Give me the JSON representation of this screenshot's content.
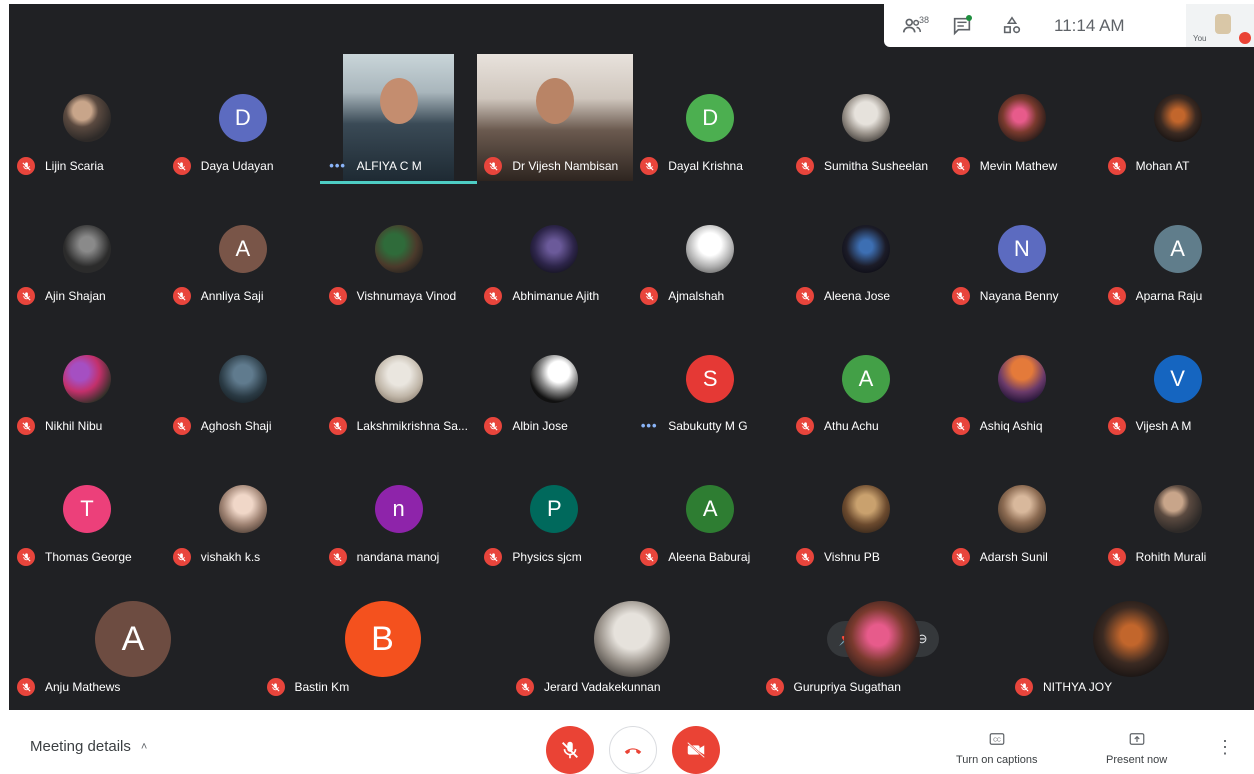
{
  "topbar": {
    "participants_count": "38",
    "clock": "11:14 AM",
    "self_label": "You"
  },
  "participants": [
    {
      "name": "Lijin Scaria",
      "avatar": "photo",
      "status": "muted"
    },
    {
      "name": "Daya Udayan",
      "avatar": "letter",
      "letter": "D",
      "color": "#5c6bc0",
      "status": "muted"
    },
    {
      "name": "ALFIYA C M",
      "avatar": "video",
      "status": "speaking"
    },
    {
      "name": "Dr Vijesh Nambisan",
      "avatar": "video",
      "status": "muted"
    },
    {
      "name": "Dayal Krishna",
      "avatar": "letter",
      "letter": "D",
      "color": "#4caf50",
      "status": "muted"
    },
    {
      "name": "Sumitha Susheelan",
      "avatar": "photo",
      "status": "muted"
    },
    {
      "name": "Mevin Mathew",
      "avatar": "photo",
      "status": "muted"
    },
    {
      "name": "Mohan AT",
      "avatar": "photo",
      "status": "muted"
    },
    {
      "name": "Ajin Shajan",
      "avatar": "photo",
      "status": "muted"
    },
    {
      "name": "Annliya Saji",
      "avatar": "letter",
      "letter": "A",
      "color": "#795548",
      "status": "muted"
    },
    {
      "name": "Vishnumaya Vinod",
      "avatar": "photo",
      "status": "muted"
    },
    {
      "name": "Abhimanue Ajith",
      "avatar": "photo",
      "status": "muted"
    },
    {
      "name": "Ajmalshah",
      "avatar": "photo",
      "status": "muted"
    },
    {
      "name": "Aleena Jose",
      "avatar": "photo",
      "status": "muted"
    },
    {
      "name": "Nayana Benny",
      "avatar": "letter",
      "letter": "N",
      "color": "#5c6bc0",
      "status": "muted"
    },
    {
      "name": "Aparna Raju",
      "avatar": "letter",
      "letter": "A",
      "color": "#607d8b",
      "status": "muted"
    },
    {
      "name": "Nikhil Nibu",
      "avatar": "photo",
      "status": "muted"
    },
    {
      "name": "Aghosh Shaji",
      "avatar": "photo",
      "status": "muted"
    },
    {
      "name": "Lakshmikrishna Sa...",
      "avatar": "photo",
      "status": "muted"
    },
    {
      "name": "Albin Jose",
      "avatar": "photo",
      "status": "muted"
    },
    {
      "name": "Sabukutty M G",
      "avatar": "letter",
      "letter": "S",
      "color": "#e53935",
      "status": "talking"
    },
    {
      "name": "Athu Achu",
      "avatar": "letter",
      "letter": "A",
      "color": "#43a047",
      "status": "muted"
    },
    {
      "name": "Ashiq Ashiq",
      "avatar": "photo",
      "status": "muted"
    },
    {
      "name": "Vijesh A M",
      "avatar": "letter",
      "letter": "V",
      "color": "#1565c0",
      "status": "muted"
    },
    {
      "name": "Thomas George",
      "avatar": "letter",
      "letter": "T",
      "color": "#ec407a",
      "status": "muted"
    },
    {
      "name": "vishakh k.s",
      "avatar": "photo",
      "status": "muted"
    },
    {
      "name": "nandana manoj",
      "avatar": "letter",
      "letter": "n",
      "color": "#8e24aa",
      "status": "muted"
    },
    {
      "name": "Physics sjcm",
      "avatar": "letter",
      "letter": "P",
      "color": "#00695c",
      "status": "muted"
    },
    {
      "name": "Aleena Baburaj",
      "avatar": "letter",
      "letter": "A",
      "color": "#2e7d32",
      "status": "muted"
    },
    {
      "name": "Vishnu PB",
      "avatar": "photo",
      "status": "muted"
    },
    {
      "name": "Adarsh Sunil",
      "avatar": "photo",
      "status": "muted"
    },
    {
      "name": "Rohith Murali",
      "avatar": "photo",
      "status": "muted"
    },
    {
      "name": "Anju Mathews",
      "avatar": "letter",
      "letter": "A",
      "color": "#6d4c41",
      "status": "muted"
    },
    {
      "name": "Bastin Km",
      "avatar": "letter",
      "letter": "B",
      "color": "#f4511e",
      "status": "muted"
    },
    {
      "name": "Jerard Vadakekunnan",
      "avatar": "photo",
      "status": "muted"
    },
    {
      "name": "Gurupriya Sugathan",
      "avatar": "photo",
      "status": "muted"
    },
    {
      "name": "NITHYA JOY",
      "avatar": "photo",
      "status": "muted"
    }
  ],
  "bottombar": {
    "meeting_details": "Meeting details",
    "captions_label": "Turn on captions",
    "present_label": "Present now"
  },
  "colors": {
    "grid_bg": "#202124",
    "mute_red": "#ea4335",
    "speaking": "#4ecdc4"
  }
}
